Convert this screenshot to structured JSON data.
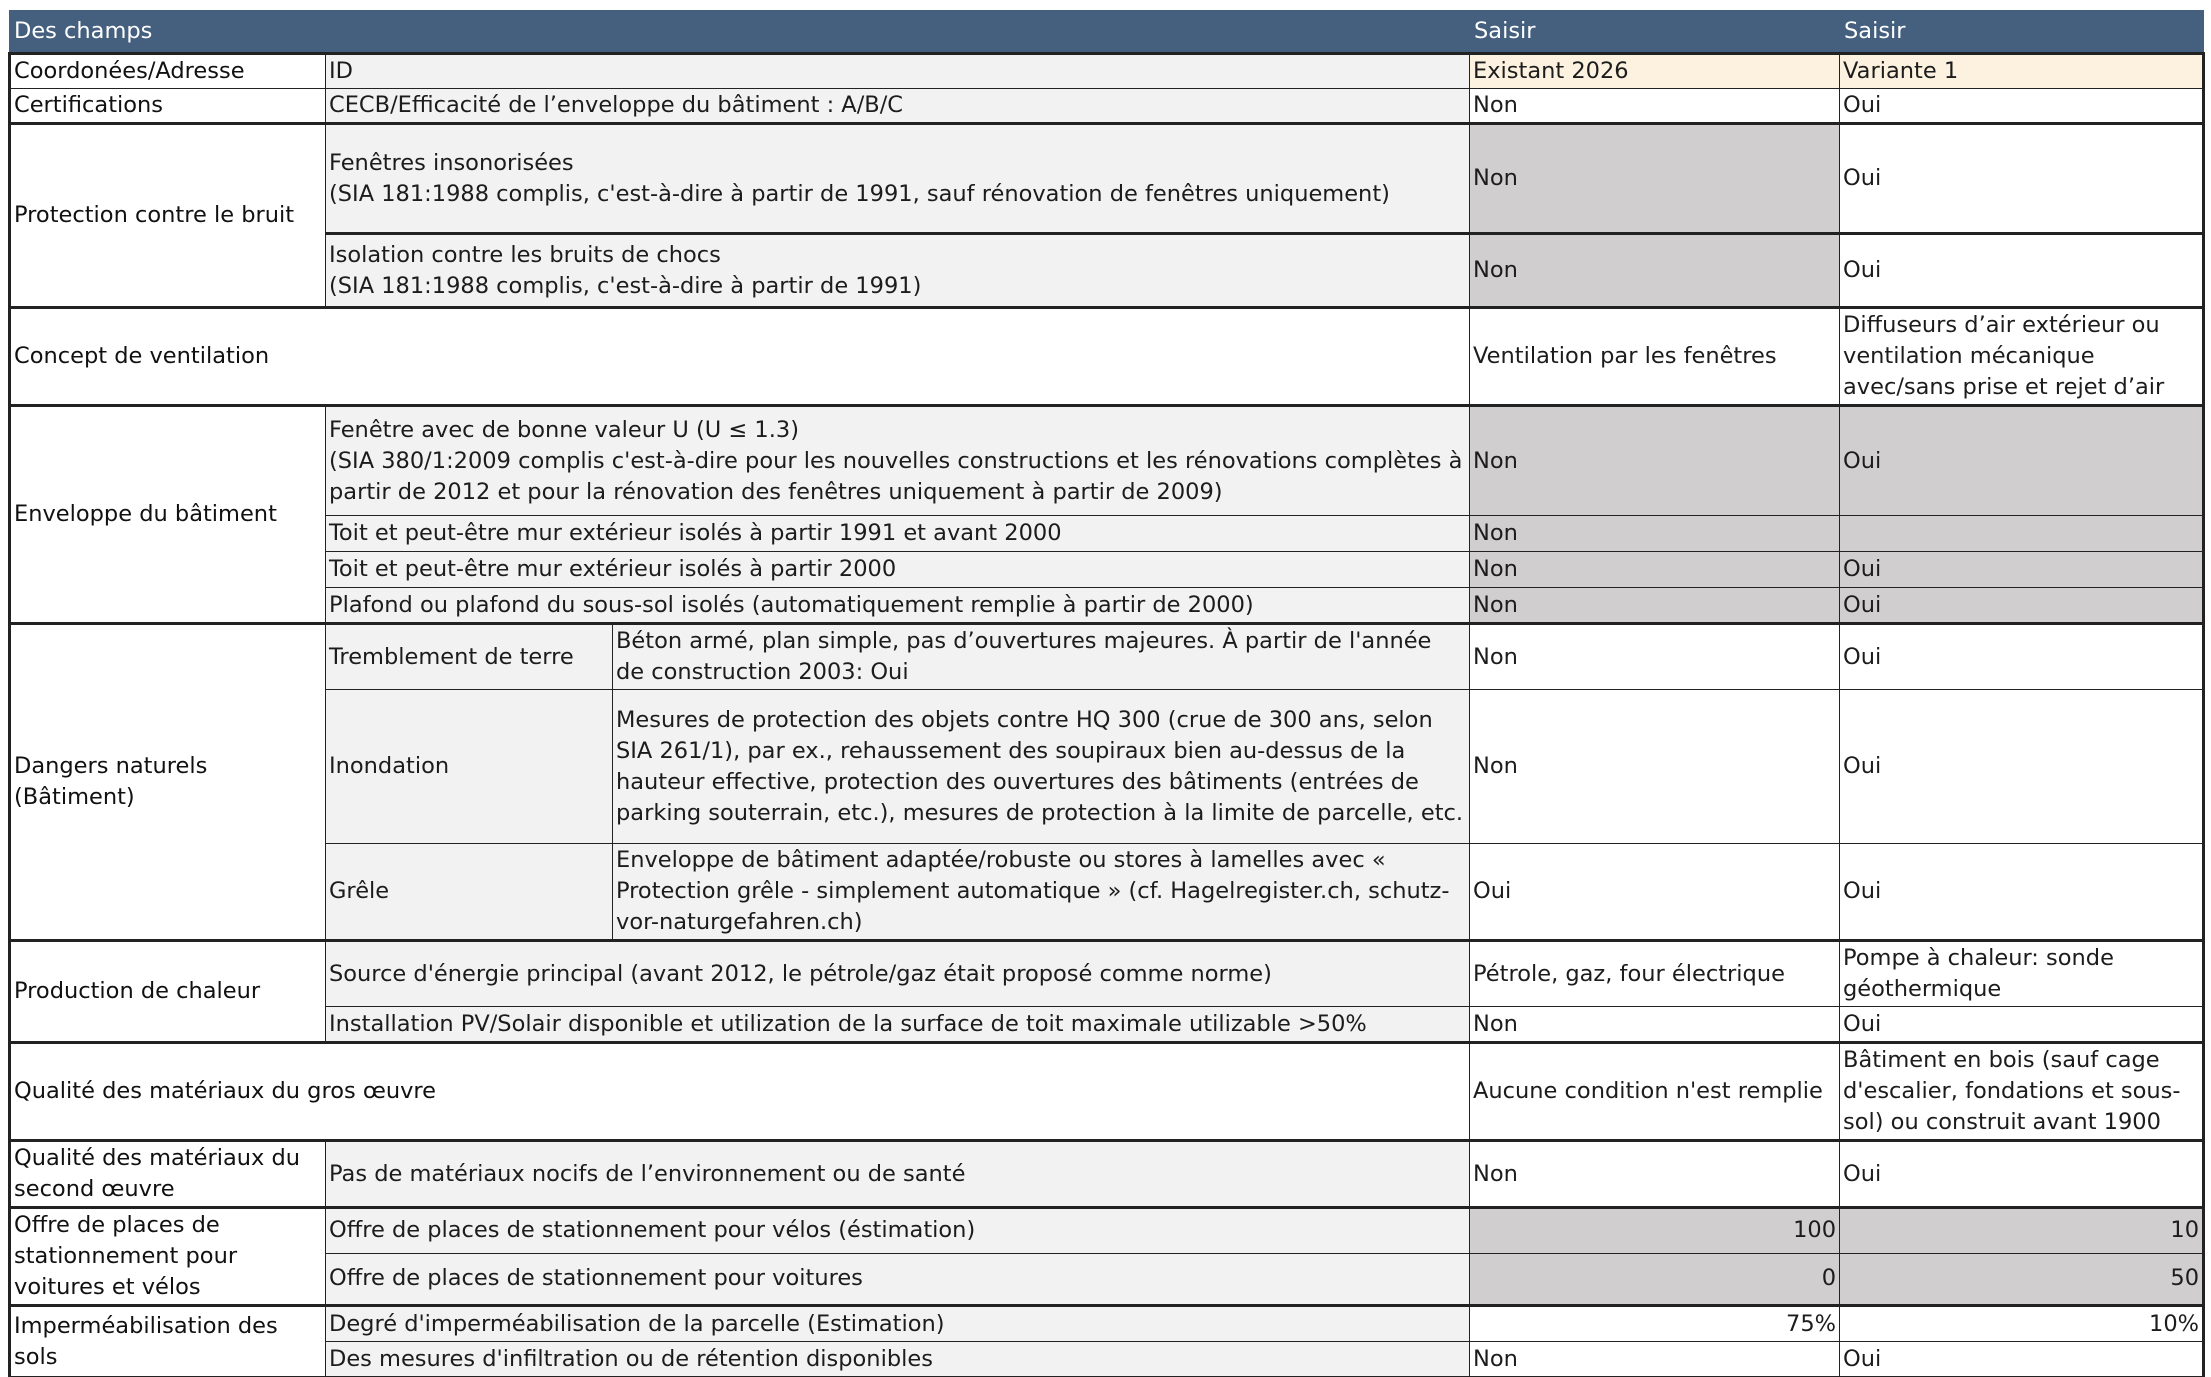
{
  "header": {
    "fields": "Des champs",
    "enter1": "Saisir",
    "enter2": "Saisir"
  },
  "rows": {
    "coords_label": "Coordonées/Adresse",
    "id_label": "ID",
    "id_v1": "Existant 2026",
    "id_v2": "Variante 1",
    "cert_label": "Certifications",
    "cert_sub": "CECB/Efficacité de l’enveloppe du bâtiment : A/B/C",
    "cert_v1": "Non",
    "cert_v2": "Oui",
    "noise_label": "Protection contre le bruit",
    "noise_sub1": "Fenêtres insonorisées\n(SIA 181:1988 complis, c'est-à-dire à partir de 1991, sauf rénovation de fenêtres uniquement)",
    "noise_sub1_v1": "Non",
    "noise_sub1_v2": "Oui",
    "noise_sub2": "Isolation contre les bruits de chocs\n(SIA 181:1988 complis, c'est-à-dire à partir de 1991)",
    "noise_sub2_v1": "Non",
    "noise_sub2_v2": "Oui",
    "vent_label": "Concept de ventilation",
    "vent_v1": "Ventilation par les fenêtres",
    "vent_v2": "Diffuseurs d’air extérieur ou ventilation mécanique avec/sans prise et rejet d’air",
    "env_label": "Enveloppe du bâtiment",
    "env_sub1": "Fenêtre avec de bonne valeur U (U ≤ 1.3)\n(SIA 380/1:2009 complis c'est-à-dire pour les nouvelles constructions et les rénovations complètes à partir de 2012 et pour la rénovation des fenêtres uniquement à partir de 2009)",
    "env_sub1_v1": "Non",
    "env_sub1_v2": "Oui",
    "env_sub2": "Toit et peut-être mur extérieur isolés à partir 1991 et avant 2000",
    "env_sub2_v1": "Non",
    "env_sub2_v2": "",
    "env_sub3": "Toit et peut-être mur extérieur isolés à partir 2000",
    "env_sub3_v1": "Non",
    "env_sub3_v2": "Oui",
    "env_sub4": "Plafond ou plafond du sous-sol isolés (automatiquement remplie à partir de 2000)",
    "env_sub4_v1": "Non",
    "env_sub4_v2": "Oui",
    "nat_label": "Dangers naturels\n(Bâtiment)",
    "nat_quake": "Tremblement de terre",
    "nat_quake_desc": "Béton armé, plan simple, pas d’ouvertures majeures. À partir de l'année de construction 2003: Oui",
    "nat_quake_v1": "Non",
    "nat_quake_v2": "Oui",
    "nat_flood": "Inondation",
    "nat_flood_desc": "Mesures de protection des objets contre HQ 300 (crue de 300 ans, selon SIA 261/1), par ex., rehaussement des soupiraux bien au-dessus de la hauteur effective, protection des ouvertures des bâtiments (entrées de parking souterrain, etc.), mesures de protection à la limite de parcelle, etc.",
    "nat_flood_v1": "Non",
    "nat_flood_v2": "Oui",
    "nat_hail": "Grêle",
    "nat_hail_desc": "Enveloppe de bâtiment adaptée/robuste ou stores à lamelles avec « Protection grêle - simplement automatique » (cf. Hagelregister.ch, schutz-vor-naturgefahren.ch)",
    "nat_hail_v1": "Oui",
    "nat_hail_v2": "Oui",
    "heat_label": "Production de chaleur",
    "heat_sub1": "Source d'énergie principal (avant 2012, le pétrole/gaz était proposé comme norme)",
    "heat_sub1_v1": "Pétrole, gaz, four électrique",
    "heat_sub1_v2": "Pompe à chaleur:  sonde géothermique",
    "heat_sub2": "Installation PV/Solair disponible et utilization de la surface de toit maximale utilizable >50%",
    "heat_sub2_v1": "Non",
    "heat_sub2_v2": "Oui",
    "mat1_label": "Qualité des matériaux du gros œuvre",
    "mat1_v1": "Aucune condition n'est remplie",
    "mat1_v2": "Bâtiment en bois (sauf cage d'escalier, fondations et sous-sol) ou construit avant 1900",
    "mat2_label": "Qualité des matériaux du second œuvre",
    "mat2_sub": "Pas de matériaux nocifs de l’environnement ou de santé",
    "mat2_v1": "Non",
    "mat2_v2": "Oui",
    "park_label": "Offre de places de stationnement pour voitures et vélos",
    "park_sub1": "Offre de places de stationnement pour vélos (éstimation)",
    "park_sub1_v1": "100",
    "park_sub1_v2": "10",
    "park_sub2": "Offre de places de stationnement pour voitures",
    "park_sub2_v1": "0",
    "park_sub2_v2": "50",
    "soil_label": "Imperméabilisation des sols",
    "soil_sub1": "Degré d'imperméabilisation de la parcelle (Estimation)",
    "soil_sub1_v1": "75%",
    "soil_sub1_v2": "10%",
    "soil_sub2": "Des mesures d'infiltration ou de rétention disponibles",
    "soil_sub2_v1": "Non",
    "soil_sub2_v2": "Oui"
  }
}
